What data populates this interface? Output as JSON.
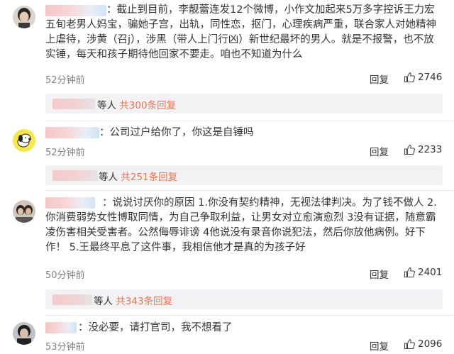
{
  "comments": [
    {
      "text": "：截止到目前，李靓蕾连发12个微博，小作文加起来5万多字控诉王力宏五旬老男人妈宝，骗她子宫，出轨，同性恋，抠门，心理疾病严重，联合家人对她精神上虐待，涉黄（召j），涉黑（带人上门行凶）新世纪最坏的男人。就是不报警，也不放实锤，每天和孩子期待他回家不要走。咱也不知道为什么",
      "time": "52分钟前",
      "reply_label": "回复",
      "likes": "2746",
      "sub": {
        "people": "等人",
        "link": "共300条回复"
      }
    },
    {
      "text": "：公司过户给你了，你这是自锤吗",
      "time": "52分钟前",
      "reply_label": "回复",
      "likes": "2233",
      "sub": {
        "people": "等人",
        "link": "共251条回复"
      }
    },
    {
      "text": "：说说讨厌你的原因 1.你没有契约精神，无视法律判决。为了钱不做人 2.你消费弱势女性博取同情，为自己争取利益，让男女对立愈演愈烈 3没有证据，随意霸凌伤害相关受害者。公然侮辱诽谤 4他说没有录音你说犯法，然后你放他病例。好下作！ 5.王最终平息了这件事，我相信他才是真的为孩子好",
      "time": "50分钟前",
      "reply_label": "回复",
      "likes": "2401",
      "sub": {
        "people": "等人",
        "link": "共343条回复"
      }
    },
    {
      "text": "：没必要，请打官司，我不想看了",
      "time": "53分钟前",
      "reply_label": "回复",
      "likes": "2096"
    }
  ],
  "icons": {
    "like": "thumbs-up-icon"
  },
  "colors": {
    "link": "#eb7350",
    "time": "#808080",
    "subbar": "#f2f2f5"
  }
}
